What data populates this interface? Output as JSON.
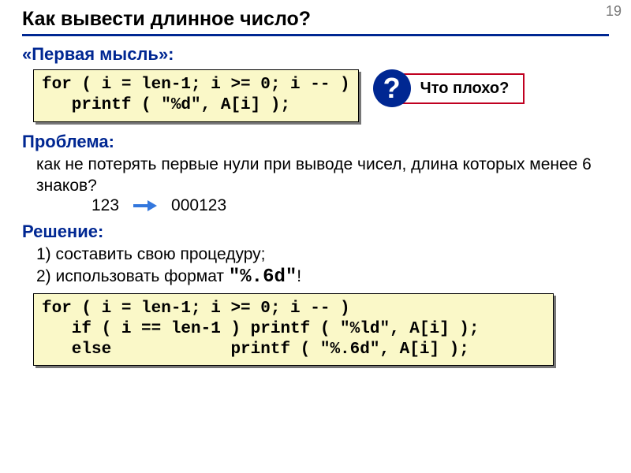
{
  "page_number": "19",
  "title": "Как вывести длинное число?",
  "section1": {
    "heading": "«Первая мысль»:",
    "code": "for ( i = len-1; i >= 0; i -- )\n   printf ( \"%d\", A[i] );",
    "question_mark": "?",
    "callout": "Что плохо?"
  },
  "section2": {
    "heading": "Проблема:",
    "text": "как не потерять первые нули при выводе чисел, длина которых менее 6 знаков?",
    "example_left": "123",
    "example_right": "000123"
  },
  "section3": {
    "heading": "Решение:",
    "item1": "1) составить свою процедуру;",
    "item2_prefix": "2) использовать формат ",
    "item2_fmt": "\"%.6d\"",
    "item2_suffix": "!",
    "code": "for ( i = len-1; i >= 0; i -- )\n   if ( i == len-1 ) printf ( \"%ld\", A[i] );\n   else            printf ( \"%.6d\", A[i] );"
  }
}
